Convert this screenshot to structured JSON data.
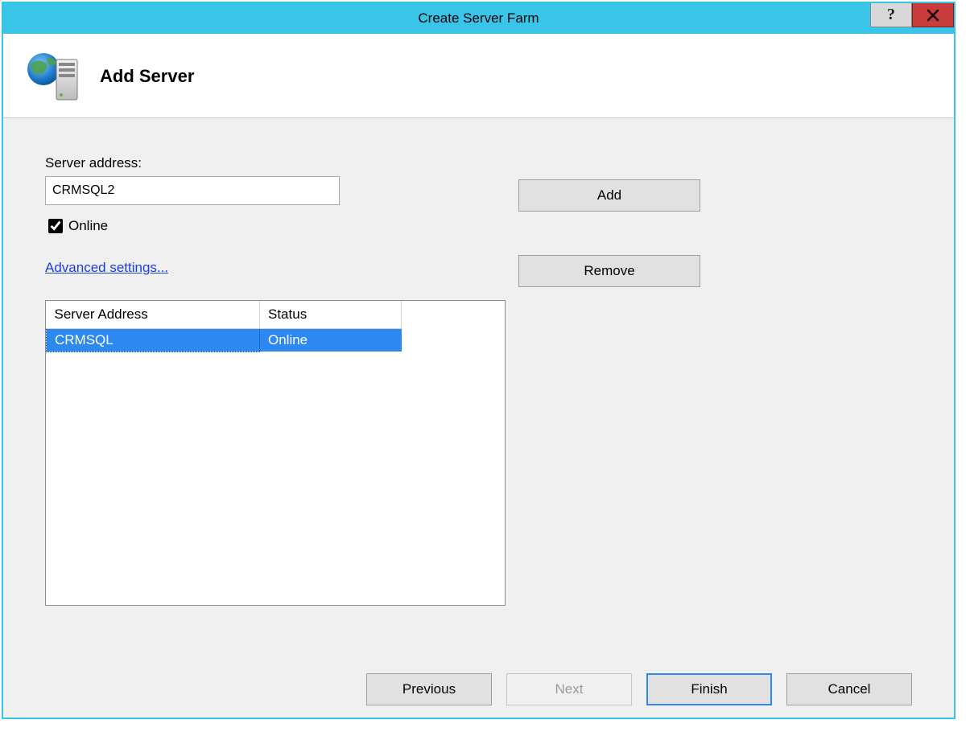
{
  "window": {
    "title": "Create Server Farm"
  },
  "header": {
    "title": "Add Server"
  },
  "form": {
    "server_address_label": "Server address:",
    "server_address_value": "CRMSQL2",
    "online_label": "Online",
    "online_checked": true,
    "advanced_link": "Advanced settings..."
  },
  "side_buttons": {
    "add": "Add",
    "remove": "Remove"
  },
  "table": {
    "columns": {
      "address": "Server Address",
      "status": "Status"
    },
    "rows": [
      {
        "address": "CRMSQL",
        "status": "Online",
        "selected": true
      }
    ]
  },
  "footer": {
    "previous": "Previous",
    "next": "Next",
    "finish": "Finish",
    "cancel": "Cancel"
  }
}
